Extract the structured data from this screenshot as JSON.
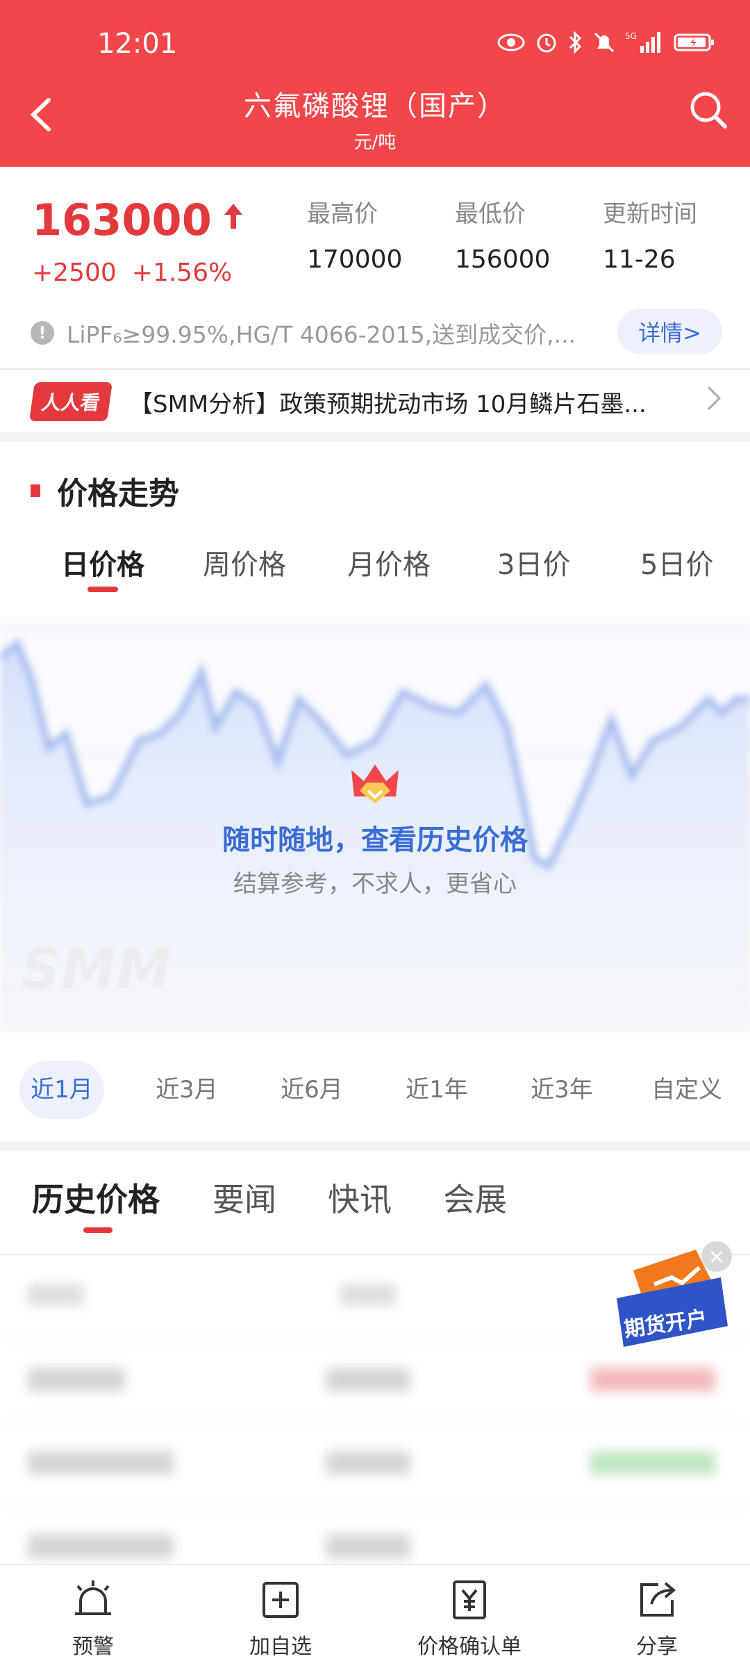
{
  "status_bar": {
    "time": "12:01",
    "icons": [
      "eye-icon",
      "alarm-icon",
      "bluetooth-icon",
      "bell-off-icon",
      "signal-5g-icon",
      "battery-icon"
    ]
  },
  "header": {
    "title": "六氟磷酸锂（国产）",
    "subtitle": "元/吨",
    "bg_color": "#f2464a"
  },
  "summary": {
    "price": "163000",
    "change_abs": "+2500",
    "change_pct": "+1.56%",
    "stats": [
      {
        "label": "最高价",
        "value": "170000"
      },
      {
        "label": "最低价",
        "value": "156000"
      },
      {
        "label": "更新时间",
        "value": "11-26"
      }
    ],
    "spec_text": "LiPF₆≥99.95%,HG/T 4066-2015,送到成交价,...",
    "detail_label": "详情>",
    "accent_color": "#e4393c"
  },
  "news": {
    "badge": "人人看",
    "text": "【SMM分析】政策预期扰动市场  10月鳞片石墨..."
  },
  "trend": {
    "section_title": "价格走势",
    "period_tabs": [
      "日价格",
      "周价格",
      "月价格",
      "3日价",
      "5日价"
    ],
    "active_period": 0,
    "overlay_title": "随时随地，查看历史价格",
    "overlay_sub": "结算参考，不求人，更省心",
    "watermark": "SMM",
    "range_tabs": [
      "近1月",
      "近3月",
      "近6月",
      "近1年",
      "近3年",
      "自定义"
    ],
    "active_range": 0
  },
  "info": {
    "tabs": [
      "历史价格",
      "要闻",
      "快讯",
      "会展"
    ],
    "active_tab": 0
  },
  "float_ad": {
    "label": "期货开户"
  },
  "bottom_nav": [
    {
      "label": "预警",
      "icon": "alarm-bell-icon"
    },
    {
      "label": "加自选",
      "icon": "add-favorite-icon"
    },
    {
      "label": "价格确认单",
      "icon": "price-confirm-icon"
    },
    {
      "label": "分享",
      "icon": "share-icon"
    }
  ]
}
